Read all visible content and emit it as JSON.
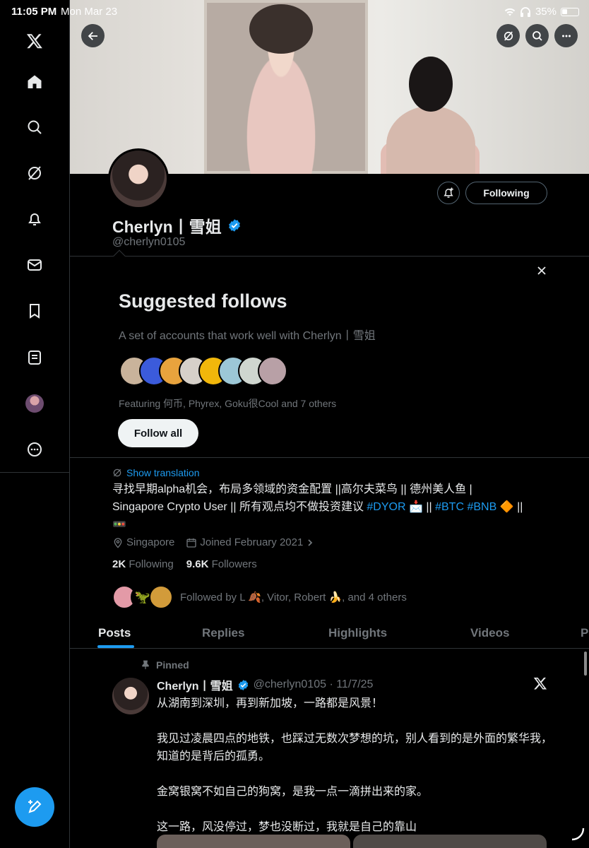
{
  "status_bar": {
    "time": "11:05 PM",
    "date": "Mon Mar 23",
    "battery": "35%"
  },
  "profile": {
    "name": "Cherlyn丨雪姐",
    "handle": "@cherlyn0105",
    "following_button": "Following"
  },
  "suggested": {
    "title": "Suggested follows",
    "subtitle": "A set of accounts that work well with Cherlyn丨雪姐",
    "featuring": "Featuring 何币, Phyrex, Goku很Cool and 7 others",
    "follow_all": "Follow all",
    "avatar_colors": [
      "#c9b39b",
      "#3b5bdb",
      "#e8a33d",
      "#d6d0c9",
      "#f1b70b",
      "#9cc7d6",
      "#cfd6cf",
      "#b8a0a6"
    ]
  },
  "bio": {
    "translate": "Show translation",
    "line1": "寻找早期alpha机会，布局多领域的资金配置 ||高尔夫菜鸟 || 德州美人鱼 |",
    "line2_start": "Singapore Crypto User || 所有观点均不做投资建议 ",
    "tag_dyor": "#DYOR",
    "line2_mid": " 📩 || ",
    "tag_btc": "#BTC",
    "tag_bnb": "#BNB",
    "line2_end": " 🔶 ||",
    "line3": "🚥",
    "location": "Singapore",
    "joined": "Joined February 2021",
    "following_count": "2K",
    "following_label": "Following",
    "followers_count": "9.6K",
    "followers_label": "Followers",
    "followed_by": "Followed by L 🍂, Vitor, Robert 🍌, and 4 others"
  },
  "tabs": [
    "Posts",
    "Replies",
    "Highlights",
    "Videos",
    "P"
  ],
  "post": {
    "pinned": "Pinned",
    "name": "Cherlyn丨雪姐",
    "meta": "@cherlyn0105 · 11/7/25",
    "p1": "从湖南到深圳，再到新加坡，一路都是风景！",
    "p2": "我见过凌晨四点的地铁，也踩过无数次梦想的坑，别人看到的是外面的繁华我，知道的是背后的孤勇。",
    "p3": "金窝银窝不如自己的狗窝，是我一点一滴拼出来的家。",
    "p4": "这一路，风没停过，梦也没断过，我就是自己的靠山"
  },
  "colors": {
    "accent": "#1d9bf0",
    "background": "#000000",
    "muted": "#71767b"
  }
}
